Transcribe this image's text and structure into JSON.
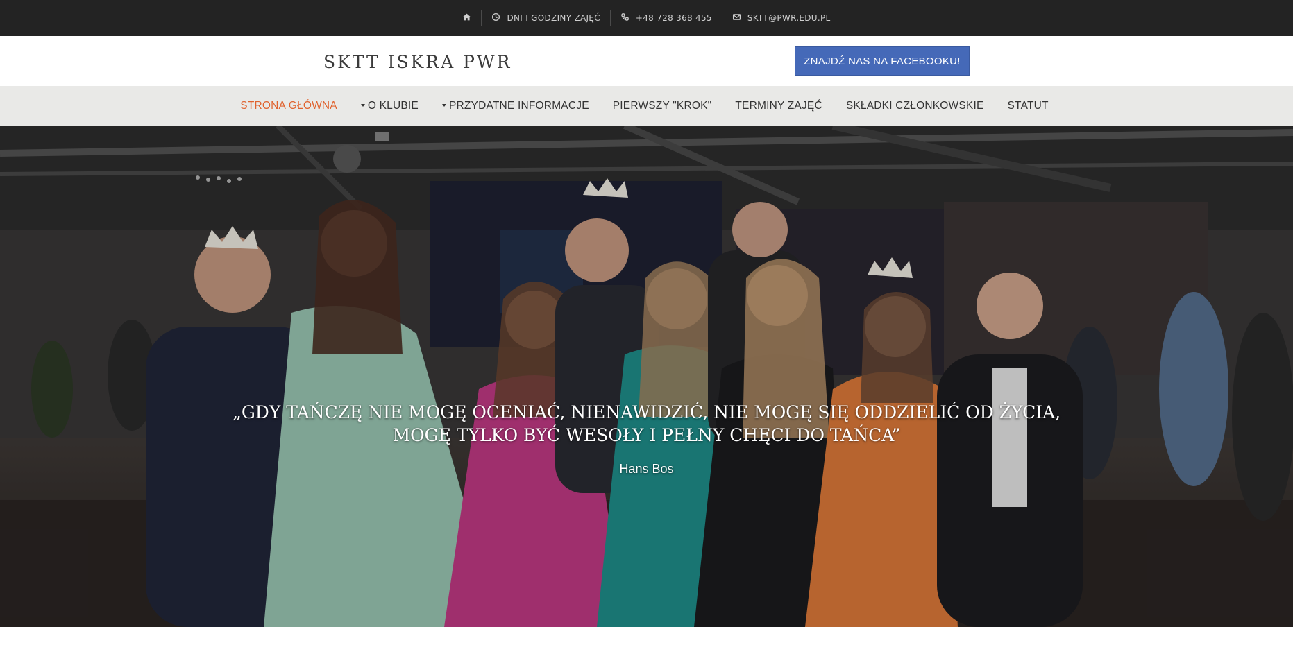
{
  "topbar": {
    "items": [
      {
        "icon": "home-icon",
        "label": ""
      },
      {
        "icon": "clock-icon",
        "label": "DNI I GODZINY ZAJĘĆ"
      },
      {
        "icon": "phone-icon",
        "label": "+48 728 368 455"
      },
      {
        "icon": "envelope-icon",
        "label": "SKTT@PWR.EDU.PL"
      }
    ]
  },
  "header": {
    "logo": "SKTT ISKRA PWR",
    "facebook_button": "ZNAJDŹ NAS NA FACEBOOKU!"
  },
  "nav": {
    "items": [
      {
        "label": "STRONA GŁÓWNA",
        "active": true,
        "dropdown": false
      },
      {
        "label": "O KLUBIE",
        "active": false,
        "dropdown": true
      },
      {
        "label": "PRZYDATNE INFORMACJE",
        "active": false,
        "dropdown": true
      },
      {
        "label": "PIERWSZY \"KROK\"",
        "active": false,
        "dropdown": false
      },
      {
        "label": "TERMINY ZAJĘĆ",
        "active": false,
        "dropdown": false
      },
      {
        "label": "SKŁADKI CZŁONKOWSKIE",
        "active": false,
        "dropdown": false
      },
      {
        "label": "STATUT",
        "active": false,
        "dropdown": false
      }
    ]
  },
  "hero": {
    "quote_line1": "„GDY TAŃCZĘ NIE MOGĘ OCENIAĆ, NIENAWIDZIĆ, NIE MOGĘ SIĘ ODDZIELIĆ OD ŻYCIA,",
    "quote_line2": "MOGĘ TYLKO BYĆ WESOŁY I PEŁNY CHĘCI DO TAŃCA”",
    "author": "Hans Bos"
  },
  "colors": {
    "topbar_bg": "#232323",
    "accent_active": "#e0632f",
    "facebook_blue": "#4569b8",
    "nav_bg": "#e9e9e7"
  }
}
